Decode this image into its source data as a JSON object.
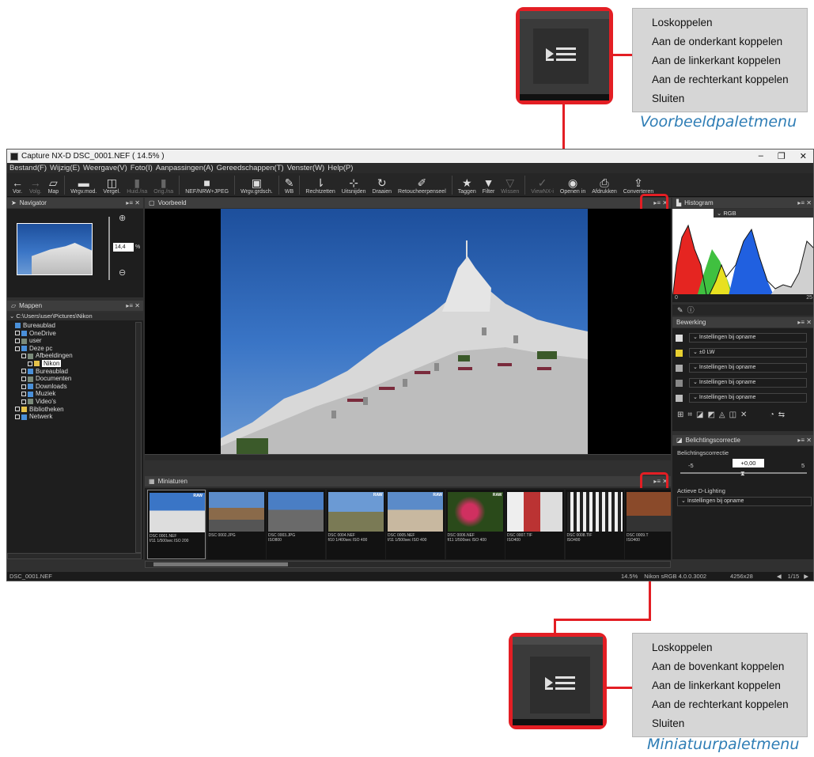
{
  "callout_top": {
    "menu": [
      "Loskoppelen",
      "Aan de onderkant koppelen",
      "Aan de linkerkant koppelen",
      "Aan de rechterkant koppelen",
      "Sluiten"
    ],
    "caption": "Voorbeeldpaletmenu"
  },
  "callout_bottom": {
    "menu": [
      "Loskoppelen",
      "Aan de bovenkant koppelen",
      "Aan de linkerkant koppelen",
      "Aan de rechterkant koppelen",
      "Sluiten"
    ],
    "caption": "Miniatuurpaletmenu"
  },
  "window": {
    "title": "Capture NX-D    DSC_0001.NEF ( 14.5% )",
    "controls": [
      "–",
      "❐",
      "✕"
    ]
  },
  "menubar": [
    "Bestand(F)",
    "Wijzig(E)",
    "Weergave(V)",
    "Foto(I)",
    "Aanpassingen(A)",
    "Gereedschappen(T)",
    "Venster(W)",
    "Help(P)"
  ],
  "toolbar": [
    {
      "icon": "←",
      "label": "Vor.",
      "icon_name": "back-arrow-icon"
    },
    {
      "icon": "→",
      "label": "Volg.",
      "icon_name": "forward-arrow-icon",
      "dim": true
    },
    {
      "icon": "▱",
      "label": "Map",
      "icon_name": "folder-icon"
    },
    {
      "icon": "▬",
      "label": "Wrgv.mod.",
      "icon_name": "view-mode-icon"
    },
    {
      "icon": "◫",
      "label": "Vergel.",
      "icon_name": "compare-icon"
    },
    {
      "icon": "▮",
      "label": "Huid./na",
      "icon_name": "current-after-icon",
      "dim": true
    },
    {
      "icon": "▮",
      "label": "Orig./na",
      "icon_name": "original-after-icon",
      "dim": true
    },
    {
      "icon": "■",
      "label": "NEF/NRW+JPEG",
      "icon_name": "nef-jpeg-icon"
    },
    {
      "icon": "▣",
      "label": "Wrgv.grdsch.",
      "icon_name": "view-grid-icon"
    },
    {
      "icon": "✎",
      "label": "WB",
      "icon_name": "white-balance-icon"
    },
    {
      "icon": "⇂",
      "label": "Rechtzetten",
      "icon_name": "straighten-icon"
    },
    {
      "icon": "⊹",
      "label": "Uitsnijden",
      "icon_name": "crop-icon"
    },
    {
      "icon": "↻",
      "label": "Draaien",
      "icon_name": "rotate-icon"
    },
    {
      "icon": "✐",
      "label": "Retoucheerpenseel",
      "icon_name": "retouch-brush-icon"
    },
    {
      "icon": "★",
      "label": "Taggen",
      "icon_name": "tag-icon"
    },
    {
      "icon": "▼",
      "label": "Filter",
      "icon_name": "filter-icon"
    },
    {
      "icon": "▽",
      "label": "Wissen",
      "icon_name": "clear-icon",
      "dim": true
    },
    {
      "icon": "✓",
      "label": "ViewNX-i",
      "icon_name": "viewnx-icon",
      "dim": true
    },
    {
      "icon": "◉",
      "label": "Openen in",
      "icon_name": "open-in-icon"
    },
    {
      "icon": "⎙",
      "label": "Afdrukken",
      "icon_name": "print-icon"
    },
    {
      "icon": "⇪",
      "label": "Converteren",
      "icon_name": "convert-icon"
    }
  ],
  "navigator": {
    "title": "Navigator",
    "zoom": "14,4",
    "unit": "%"
  },
  "folders": {
    "title": "Mappen",
    "path": "C:\\Users\\user\\Pictures\\Nikon",
    "items": [
      {
        "label": "Bureaublad",
        "indent": 0,
        "color": "b"
      },
      {
        "label": "OneDrive",
        "indent": 1,
        "color": "b"
      },
      {
        "label": "user",
        "indent": 1,
        "color": "g"
      },
      {
        "label": "Deze pc",
        "indent": 1,
        "color": "b"
      },
      {
        "label": "Afbeeldingen",
        "indent": 2,
        "color": "g"
      },
      {
        "label": "Nikon",
        "indent": 3,
        "color": "y",
        "selected": true
      },
      {
        "label": "Bureaublad",
        "indent": 2,
        "color": "b"
      },
      {
        "label": "Documenten",
        "indent": 2,
        "color": "g"
      },
      {
        "label": "Downloads",
        "indent": 2,
        "color": "b"
      },
      {
        "label": "Muziek",
        "indent": 2,
        "color": "b"
      },
      {
        "label": "Video's",
        "indent": 2,
        "color": "g"
      },
      {
        "label": "Bibliotheken",
        "indent": 1,
        "color": "y"
      },
      {
        "label": "Netwerk",
        "indent": 1,
        "color": "b"
      }
    ]
  },
  "preview": {
    "title": "Voorbeeld"
  },
  "thumbnails": {
    "title": "Miniaturen",
    "items": [
      {
        "name": "DSC 0001.NEF",
        "info": "f/11 1/500sec ISO 200",
        "raw": true
      },
      {
        "name": "DSC 0002.JPG",
        "info": "",
        "raw": false
      },
      {
        "name": "DSC 0003.JPG",
        "info": "ISO800",
        "raw": false
      },
      {
        "name": "DSC 0004.NEF",
        "info": "f/10 1/400sec ISO 400",
        "raw": true
      },
      {
        "name": "DSC 0005.NEF",
        "info": "f/11 1/500sec ISO 400",
        "raw": true
      },
      {
        "name": "DSC 0006.NEF",
        "info": "f/11 1/500sec ISO 400",
        "raw": true
      },
      {
        "name": "DSC 0007.TIF",
        "info": "ISO400",
        "raw": false
      },
      {
        "name": "DSC 0008.TIF",
        "info": "ISO400",
        "raw": false
      },
      {
        "name": "DSC 0009.T",
        "info": "ISO400",
        "raw": false
      }
    ]
  },
  "histogram": {
    "title": "Histogram",
    "channel": "RGB",
    "min": "0",
    "max": "25"
  },
  "editing": {
    "title": "Bewerking",
    "rows": [
      "Instellingen bij opname",
      "±0 LW",
      "Instellingen bij opname",
      "Instellingen bij opname",
      "Instellingen bij opname"
    ]
  },
  "exposure": {
    "title": "Belichtingscorrectie",
    "label": "Belichtingscorrectie",
    "min": "-5",
    "value": "+0,00",
    "max": "5",
    "dlighting_label": "Actieve D-Lighting",
    "dlighting_value": "Instellingen bij opname"
  },
  "statusbar": {
    "file": "DSC_0001.NEF",
    "zoom": "14.5%",
    "profile": "Nikon sRGB 4.0.0.3002",
    "dims": "4256x28",
    "page": "1/15"
  }
}
